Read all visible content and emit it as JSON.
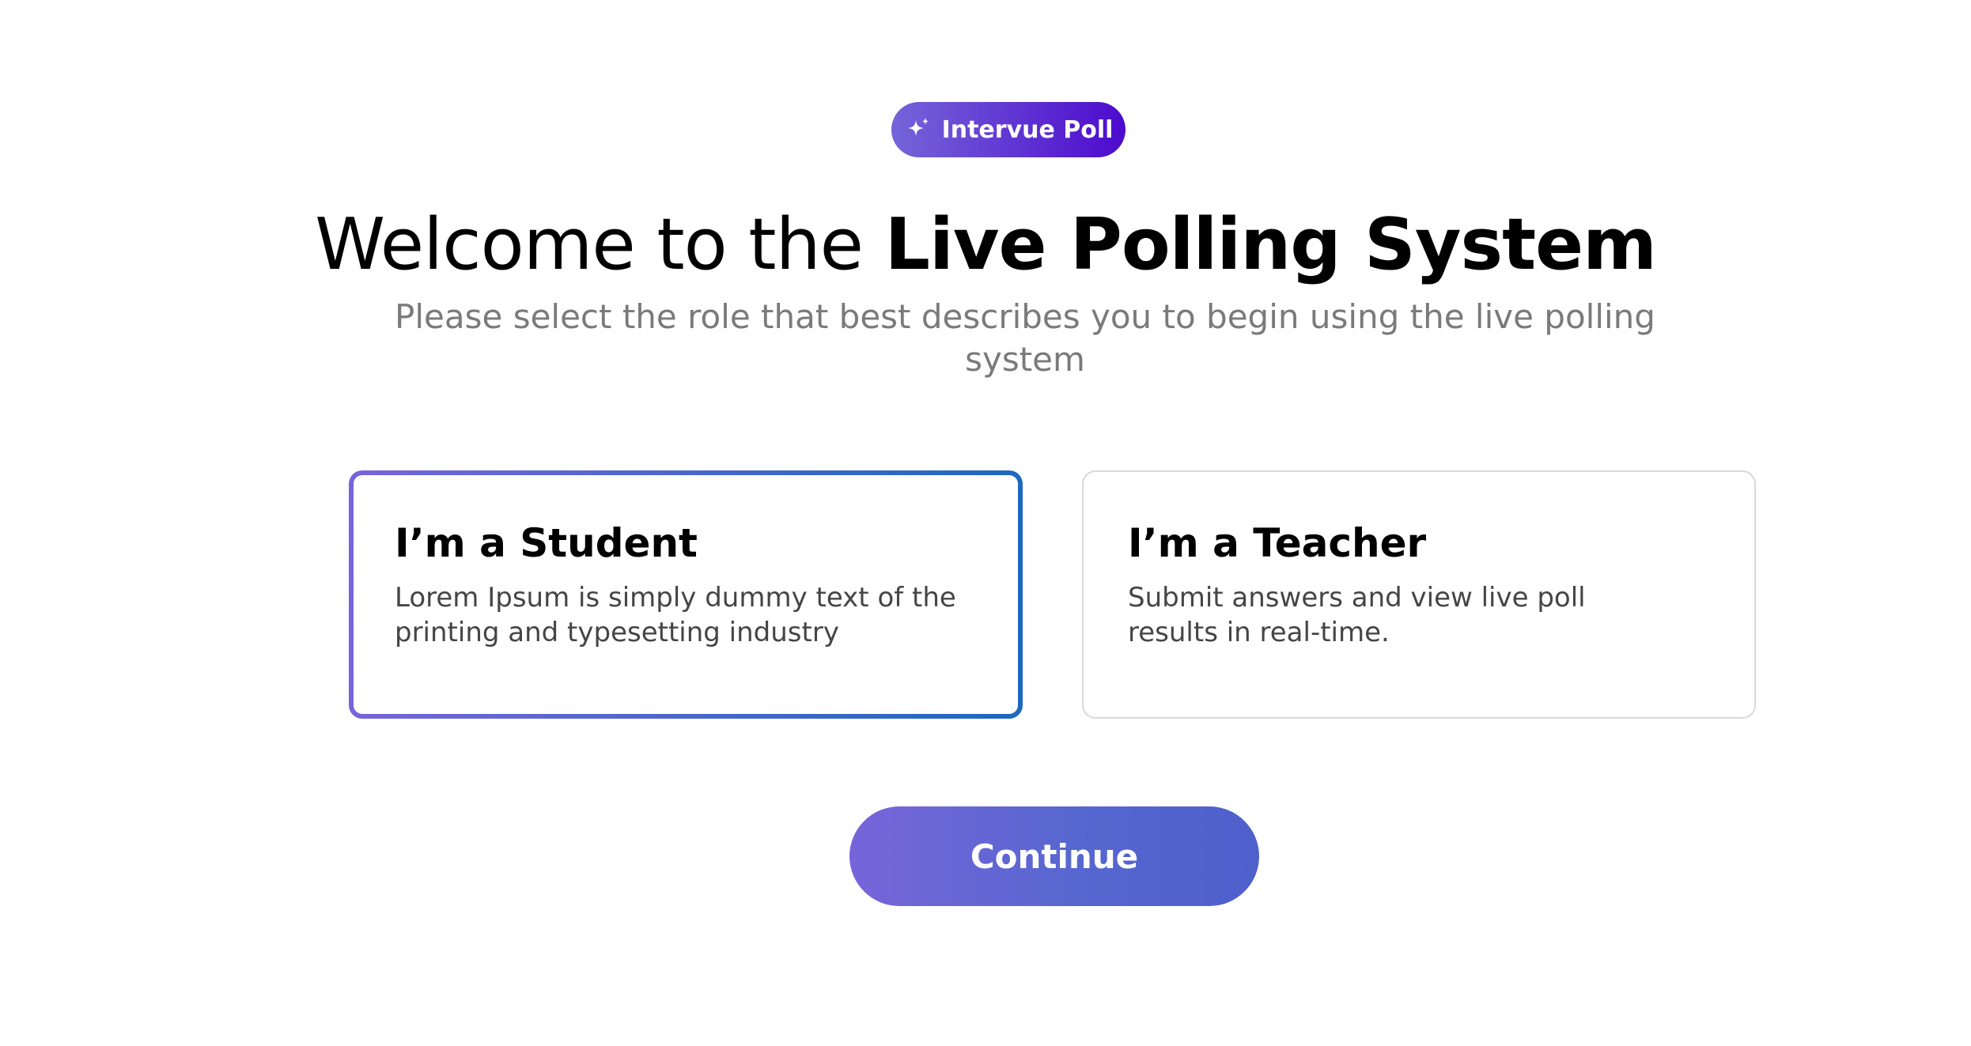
{
  "badge": {
    "icon": "sparkle-icon",
    "label": "Intervue Poll",
    "gradient": [
      "#7565D9",
      "#4D0ACD"
    ]
  },
  "header": {
    "title_regular": "Welcome to the ",
    "title_bold": "Live Polling System",
    "subtitle": "Please select the role that best describes you to begin using the live polling system"
  },
  "roles": [
    {
      "title": "I’m a Student",
      "description": "Lorem Ipsum is simply dummy text of the printing and typesetting industry",
      "selected": true
    },
    {
      "title": "I’m a Teacher",
      "description": "Submit answers and view live poll results in real-time.",
      "selected": false
    }
  ],
  "actions": {
    "continue_label": "Continue"
  },
  "colors": {
    "accent_start": "#7765DA",
    "accent_end": "#4F5FCB",
    "selected_border_end": "#1D68BD",
    "subtitle_text": "#7a7a7a",
    "card_text": "#454545"
  }
}
